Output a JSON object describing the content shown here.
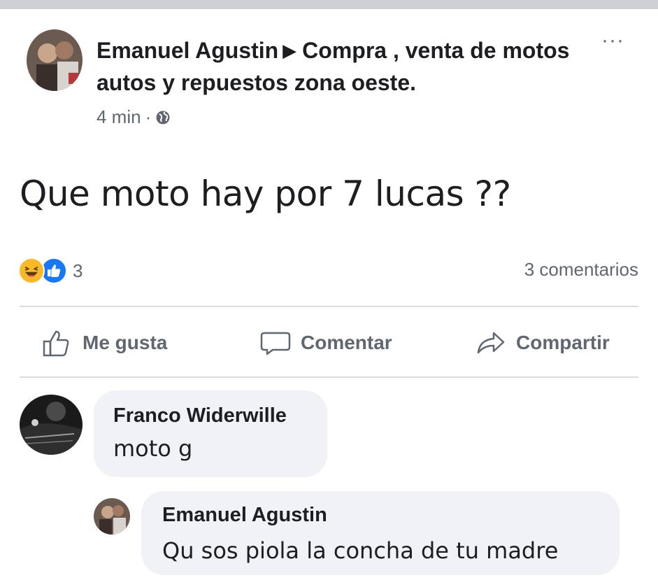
{
  "post": {
    "author": "Emanuel Agustin",
    "group": "Compra , venta de motos autos y repuestos zona oeste.",
    "time": "4 min",
    "separator": "·",
    "privacy_icon": "globe-icon",
    "menu": "···",
    "text": "Que moto hay por 7 lucas ??"
  },
  "stats": {
    "reaction_icons": [
      "haha-icon",
      "like-icon"
    ],
    "reaction_count": "3",
    "comments_label": "3 comentarios"
  },
  "actions": [
    {
      "label": "Me gusta",
      "icon": "thumbs-up-icon"
    },
    {
      "label": "Comentar",
      "icon": "speech-bubble-icon"
    },
    {
      "label": "Compartir",
      "icon": "share-arrow-icon"
    }
  ],
  "comments": [
    {
      "name": "Franco Widerwille",
      "text": "moto g"
    },
    {
      "name": "Emanuel Agustin",
      "text": "Qu sos piola la concha de tu madre"
    }
  ],
  "colors": {
    "like_blue": "#1877f2",
    "haha_yellow": "#f7b928",
    "bubble_bg": "#f0f2f5",
    "muted_text": "#606770"
  }
}
